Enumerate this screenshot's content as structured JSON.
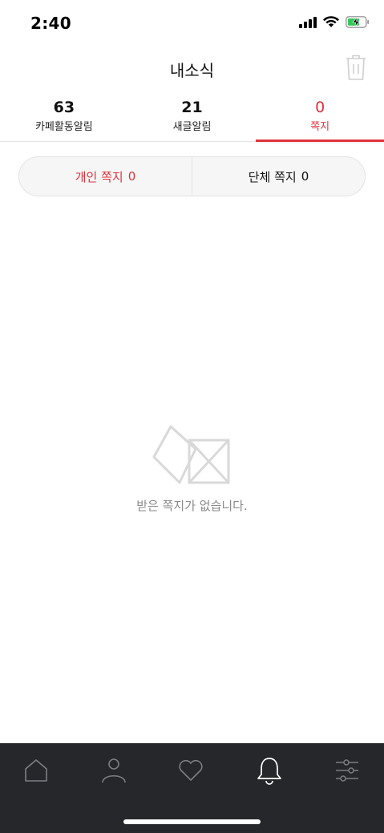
{
  "status_bar": {
    "time": "2:40"
  },
  "header": {
    "title": "내소식"
  },
  "tabs": [
    {
      "count": "63",
      "label": "카페활동알림"
    },
    {
      "count": "21",
      "label": "새글알림"
    },
    {
      "count": "0",
      "label": "쪽지"
    }
  ],
  "segment": {
    "personal": {
      "label": "개인 쪽지",
      "count": "0"
    },
    "group": {
      "label": "단체 쪽지",
      "count": "0"
    }
  },
  "empty_state": {
    "message": "받은 쪽지가 없습니다."
  },
  "colors": {
    "accent": "#e0323c",
    "nav_bg": "#26272b"
  },
  "bottom_nav": [
    {
      "icon": "home-icon"
    },
    {
      "icon": "person-icon"
    },
    {
      "icon": "heart-icon"
    },
    {
      "icon": "bell-icon"
    },
    {
      "icon": "settings-sliders-icon"
    }
  ]
}
